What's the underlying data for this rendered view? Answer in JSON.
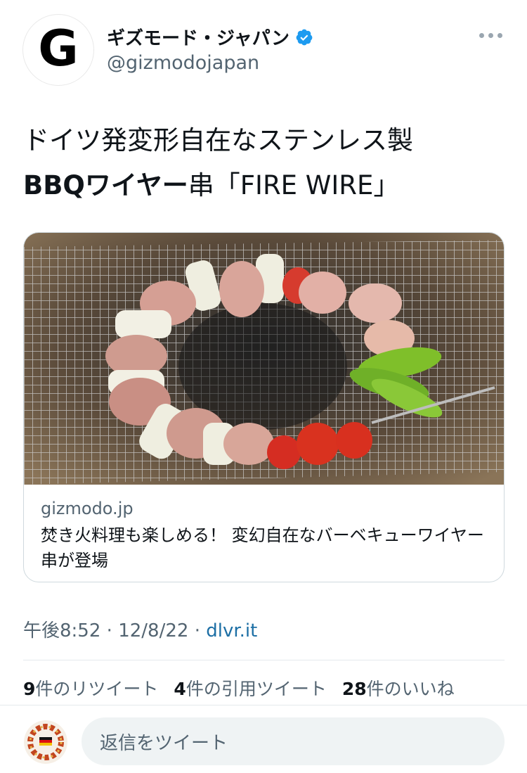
{
  "header": {
    "avatar_letter": "G",
    "display_name": "ギズモード・ジャパン",
    "handle": "@gizmodojapan"
  },
  "tweet": {
    "line1": "ドイツ発変形自在なステンレス製",
    "line2_bold": "BBQワイヤー",
    "line2_rest": "串「FIRE WIRE」"
  },
  "card": {
    "domain": "gizmodo.jp",
    "title": "焚き火料理も楽しめる！ 変幻自在なバーベキューワイヤー串が登場"
  },
  "meta": {
    "time": "午後8:52",
    "date": "12/8/22",
    "source": "dlvr.it",
    "sep": "·"
  },
  "stats": {
    "retweets_count": "9",
    "retweets_label": "件のリツイート",
    "quotes_count": "4",
    "quotes_label": "件の引用ツイート",
    "likes_count": "28",
    "likes_label": "件のいいね"
  },
  "reply": {
    "placeholder": "返信をツイート"
  },
  "colors": {
    "verified": "#1d9bf0",
    "link": "#1d6fa5",
    "secondary_text": "#536471"
  }
}
